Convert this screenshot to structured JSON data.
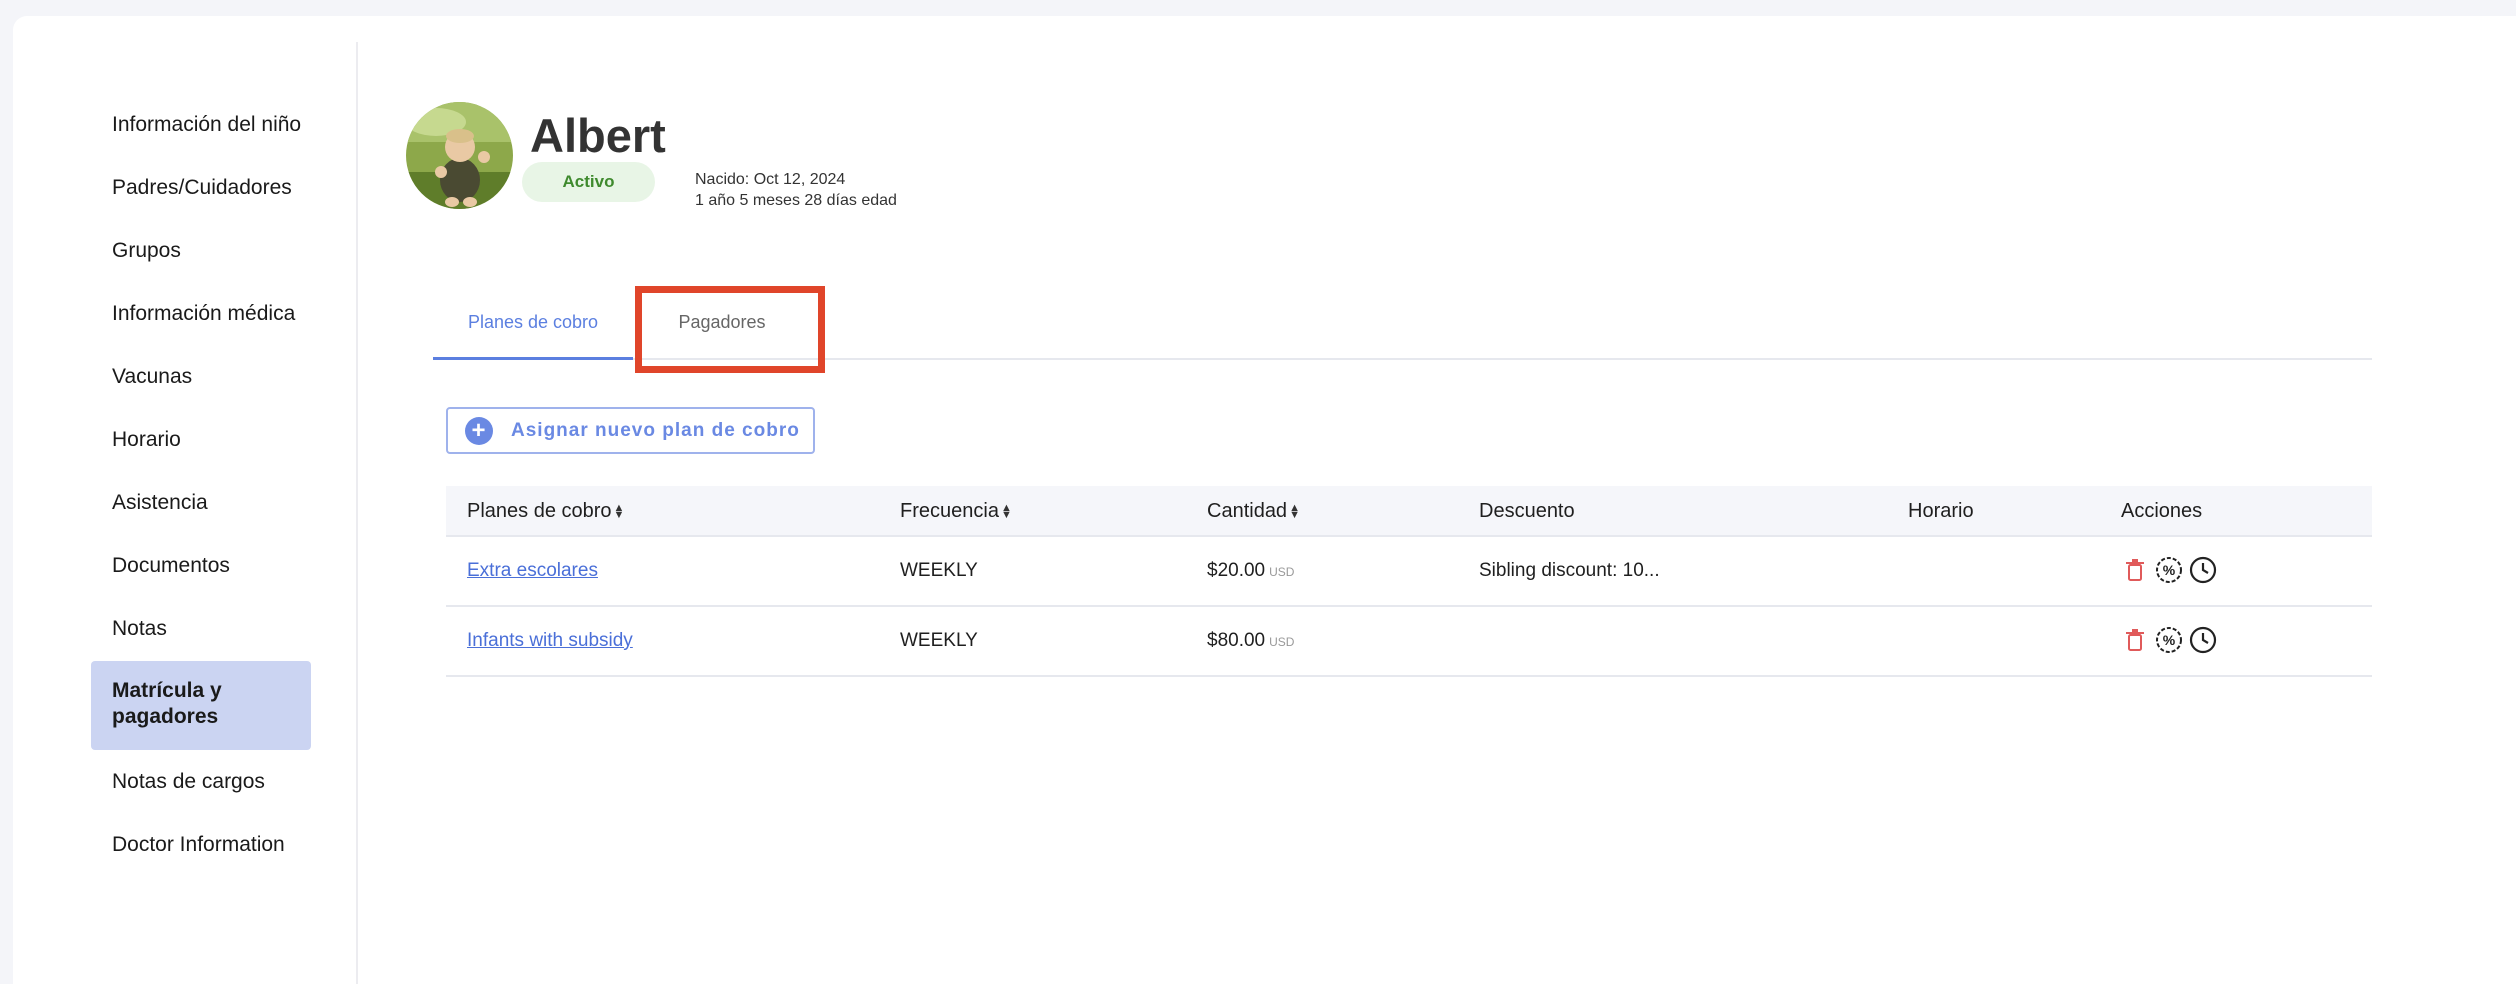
{
  "sidebar": {
    "items": [
      {
        "label": "Información del niño"
      },
      {
        "label": "Padres/Cuidadores"
      },
      {
        "label": "Grupos"
      },
      {
        "label": "Información médica"
      },
      {
        "label": "Vacunas"
      },
      {
        "label": "Horario"
      },
      {
        "label": "Asistencia"
      },
      {
        "label": "Documentos"
      },
      {
        "label": "Notas"
      },
      {
        "label": "Matrícula y pagadores"
      },
      {
        "label": "Notas de cargos"
      },
      {
        "label": "Doctor Information"
      }
    ],
    "active_index": 9
  },
  "profile": {
    "name": "Albert",
    "status": "Activo",
    "born": "Nacido: Oct 12, 2024",
    "age": "1 año 5 meses 28 días edad"
  },
  "tabs": [
    {
      "label": "Planes de cobro",
      "active": true
    },
    {
      "label": "Pagadores",
      "active": false
    }
  ],
  "assign_button": {
    "label": "Asignar nuevo plan de cobro"
  },
  "table": {
    "headers": {
      "plan": "Planes de cobro",
      "frequency": "Frecuencia",
      "amount": "Cantidad",
      "discount": "Descuento",
      "schedule": "Horario",
      "actions": "Acciones"
    },
    "rows": [
      {
        "plan": "Extra escolares",
        "frequency": "WEEKLY",
        "amount": "$20.00",
        "currency": "USD",
        "discount": "Sibling discount: 10...",
        "schedule": ""
      },
      {
        "plan": "Infants with subsidy",
        "frequency": "WEEKLY",
        "amount": "$80.00",
        "currency": "USD",
        "discount": "",
        "schedule": ""
      }
    ]
  },
  "colors": {
    "accent": "#5b7fe0",
    "active_sidebar": "#cbd4f2",
    "status_bg": "#e8f5e6",
    "status_text": "#3f8a2e",
    "delete_icon": "#e05a5a",
    "highlight": "#e0452a"
  },
  "icons": [
    "plus-icon",
    "trash-icon",
    "percent-icon",
    "clock-icon",
    "sort-icon"
  ]
}
